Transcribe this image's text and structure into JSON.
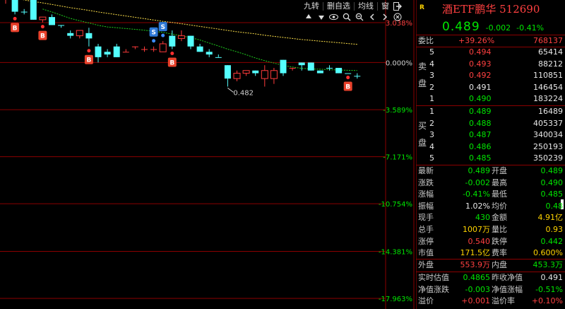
{
  "chart_data": {
    "type": "candlestick",
    "ylim_pct": [
      -18.6,
      3.6
    ],
    "pct_ticks": [
      "3.038%",
      "0.000%",
      "-3.589%",
      "-7.171%",
      "-10.754%",
      "-14.381%",
      "-17.963%"
    ],
    "candles": [
      {
        "o": 0.516,
        "h": 0.519,
        "l": 0.513,
        "c": 0.516,
        "color": "red"
      },
      {
        "o": 0.515,
        "h": 0.516,
        "l": 0.509,
        "c": 0.51,
        "color": "cyan"
      },
      {
        "o": 0.51,
        "h": 0.511,
        "l": 0.509,
        "c": 0.51,
        "color": "cyan"
      },
      {
        "o": 0.515,
        "h": 0.516,
        "l": 0.507,
        "c": 0.507,
        "color": "cyan"
      },
      {
        "o": 0.507,
        "h": 0.508,
        "l": 0.506,
        "c": 0.508,
        "color": "red"
      },
      {
        "o": 0.508,
        "h": 0.509,
        "l": 0.505,
        "c": 0.505,
        "color": "cyan"
      },
      {
        "o": 0.505,
        "h": 0.505,
        "l": 0.504,
        "c": 0.505,
        "color": "cyan"
      },
      {
        "o": 0.502,
        "h": 0.503,
        "l": 0.5,
        "c": 0.501,
        "color": "cyan"
      },
      {
        "o": 0.501,
        "h": 0.503,
        "l": 0.5,
        "c": 0.503,
        "color": "red"
      },
      {
        "o": 0.502,
        "h": 0.504,
        "l": 0.497,
        "c": 0.5,
        "color": "cyan"
      },
      {
        "o": 0.497,
        "h": 0.498,
        "l": 0.491,
        "c": 0.493,
        "color": "cyan"
      },
      {
        "o": 0.494,
        "h": 0.496,
        "l": 0.493,
        "c": 0.495,
        "color": "cyan"
      },
      {
        "o": 0.493,
        "h": 0.498,
        "l": 0.493,
        "c": 0.497,
        "color": "cyan"
      },
      {
        "o": 0.495,
        "h": 0.496,
        "l": 0.495,
        "c": 0.495,
        "color": "red"
      },
      {
        "o": 0.497,
        "h": 0.497,
        "l": 0.496,
        "c": 0.497,
        "color": "red"
      },
      {
        "o": 0.496,
        "h": 0.497,
        "l": 0.495,
        "c": 0.496,
        "color": "red"
      },
      {
        "o": 0.496,
        "h": 0.497,
        "l": 0.495,
        "c": 0.496,
        "color": "red"
      },
      {
        "o": 0.495,
        "h": 0.499,
        "l": 0.495,
        "c": 0.498,
        "color": "red"
      },
      {
        "o": 0.497,
        "h": 0.503,
        "l": 0.496,
        "c": 0.501,
        "color": "cyan"
      },
      {
        "o": 0.5,
        "h": 0.503,
        "l": 0.499,
        "c": 0.501,
        "color": "red"
      },
      {
        "o": 0.501,
        "h": 0.501,
        "l": 0.496,
        "c": 0.497,
        "color": "cyan"
      },
      {
        "o": 0.497,
        "h": 0.498,
        "l": 0.495,
        "c": 0.495,
        "color": "cyan"
      },
      {
        "o": 0.495,
        "h": 0.496,
        "l": 0.493,
        "c": 0.494,
        "color": "cyan"
      },
      {
        "o": 0.493,
        "h": 0.494,
        "l": 0.493,
        "c": 0.493,
        "color": "cyan"
      },
      {
        "o": 0.49,
        "h": 0.49,
        "l": 0.482,
        "c": 0.485,
        "color": "cyan"
      },
      {
        "o": 0.485,
        "h": 0.488,
        "l": 0.484,
        "c": 0.487,
        "color": "red"
      },
      {
        "o": 0.487,
        "h": 0.488,
        "l": 0.486,
        "c": 0.488,
        "color": "red"
      },
      {
        "o": 0.488,
        "h": 0.488,
        "l": 0.486,
        "c": 0.487,
        "color": "cyan"
      },
      {
        "o": 0.485,
        "h": 0.49,
        "l": 0.482,
        "c": 0.488,
        "color": "red"
      },
      {
        "o": 0.488,
        "h": 0.489,
        "l": 0.483,
        "c": 0.485,
        "color": "red"
      },
      {
        "o": 0.487,
        "h": 0.492,
        "l": 0.486,
        "c": 0.492,
        "color": "cyan"
      },
      {
        "o": 0.489,
        "h": 0.489,
        "l": 0.488,
        "c": 0.489,
        "color": "red"
      },
      {
        "o": 0.491,
        "h": 0.491,
        "l": 0.488,
        "c": 0.49,
        "color": "cyan"
      },
      {
        "o": 0.491,
        "h": 0.491,
        "l": 0.488,
        "c": 0.488,
        "color": "cyan"
      },
      {
        "o": 0.488,
        "h": 0.488,
        "l": 0.487,
        "c": 0.487,
        "color": "cyan"
      },
      {
        "o": 0.489,
        "h": 0.49,
        "l": 0.488,
        "c": 0.489,
        "color": "cyan"
      },
      {
        "o": 0.489,
        "h": 0.489,
        "l": 0.487,
        "c": 0.487,
        "color": "cyan"
      },
      {
        "o": 0.487,
        "h": 0.487,
        "l": 0.487,
        "c": 0.487,
        "color": "cyan"
      },
      {
        "o": 0.486,
        "h": 0.487,
        "l": 0.485,
        "c": 0.486,
        "color": "cyan"
      }
    ],
    "ma_yellow": [
      0.5155,
      0.515,
      0.5144,
      0.5138,
      0.5133,
      0.5127,
      0.5121,
      0.5115,
      0.511,
      0.5105,
      0.5099,
      0.5094,
      0.5089,
      0.5084,
      0.5079,
      0.5074,
      0.5069,
      0.5064,
      0.506,
      0.5055,
      0.505,
      0.5045,
      0.504,
      0.5035,
      0.503,
      0.5025,
      0.5021,
      0.5017,
      0.5012,
      0.5008,
      0.5004,
      0.5,
      0.4996,
      0.4993,
      0.499,
      0.4987,
      0.4984,
      0.4981,
      0.4978
    ],
    "ma_green": [
      null,
      null,
      null,
      null,
      0.511,
      0.5099,
      0.5087,
      0.5075,
      0.5066,
      0.5058,
      0.5049,
      0.5043,
      0.504,
      0.5037,
      0.5034,
      0.5031,
      0.5027,
      0.5023,
      0.5016,
      0.501,
      0.5003,
      0.4994,
      0.4983,
      0.4972,
      0.496,
      0.495,
      0.4939,
      0.4927,
      0.4917,
      0.4908,
      0.4899,
      0.4893,
      0.4888,
      0.4886,
      0.4885,
      0.4883,
      0.4882,
      0.4881,
      0.488
    ],
    "low_annotation": "0.482",
    "buy_marks": [
      {
        "i": 1,
        "label": "B"
      },
      {
        "i": 4,
        "label": "B"
      },
      {
        "i": 9,
        "label": "B"
      },
      {
        "i": 18,
        "label": "B"
      },
      {
        "i": 37,
        "label": "B"
      }
    ],
    "sell_marks": [
      {
        "i": 16,
        "label": "S"
      },
      {
        "i": 17,
        "label": "S"
      }
    ]
  },
  "toolbar": {
    "nine_turn": "九转",
    "self_select": "删自选",
    "ma_line": "均线",
    "window": "窗"
  },
  "header": {
    "r_badge": "R",
    "name": "酒ETF鹏华 512690",
    "price": "0.489",
    "change": "-0.002",
    "pct": "-0.41%"
  },
  "ratio": {
    "label": "委比",
    "value": "+39.26%",
    "diff": "768137"
  },
  "sell_side_label": [
    "卖",
    "盘"
  ],
  "buy_side_label": [
    "买",
    "盘"
  ],
  "asks": [
    {
      "n": "5",
      "price": "0.494",
      "vol": "65414",
      "color": "red"
    },
    {
      "n": "4",
      "price": "0.493",
      "vol": "88212",
      "color": "red"
    },
    {
      "n": "3",
      "price": "0.492",
      "vol": "110851",
      "color": "red"
    },
    {
      "n": "2",
      "price": "0.491",
      "vol": "146454",
      "color": "white"
    },
    {
      "n": "1",
      "price": "0.490",
      "vol": "183224",
      "color": "green"
    }
  ],
  "bids": [
    {
      "n": "1",
      "price": "0.489",
      "vol": "16489",
      "color": "green"
    },
    {
      "n": "2",
      "price": "0.488",
      "vol": "405337",
      "color": "green"
    },
    {
      "n": "3",
      "price": "0.487",
      "vol": "340034",
      "color": "green"
    },
    {
      "n": "4",
      "price": "0.486",
      "vol": "250193",
      "color": "green"
    },
    {
      "n": "5",
      "price": "0.485",
      "vol": "350239",
      "color": "green"
    }
  ],
  "stats": [
    {
      "l1": "最新",
      "v1": "0.489",
      "c1": "green",
      "l2": "开盘",
      "v2": "0.489",
      "c2": "green"
    },
    {
      "l1": "涨跌",
      "v1": "-0.002",
      "c1": "green",
      "l2": "最高",
      "v2": "0.490",
      "c2": "green"
    },
    {
      "l1": "涨幅",
      "v1": "-0.41%",
      "c1": "green",
      "l2": "最低",
      "v2": "0.485",
      "c2": "green"
    },
    {
      "l1": "振幅",
      "v1": "1.02%",
      "c1": "white",
      "l2": "均价",
      "v2": "0.48",
      "c2": "green"
    },
    {
      "l1": "现手",
      "v1": "430",
      "c1": "green",
      "l2": "金额",
      "v2": "4.91亿",
      "c2": "yellow"
    },
    {
      "l1": "总手",
      "v1": "1007万",
      "c1": "yellow",
      "l2": "量比",
      "v2": "0.93",
      "c2": "yellow"
    },
    {
      "l1": "涨停",
      "v1": "0.540",
      "c1": "red",
      "l2": "跌停",
      "v2": "0.442",
      "c2": "green"
    },
    {
      "l1": "市值",
      "v1": "171.5亿",
      "c1": "yellow",
      "l2": "费率",
      "v2": "0.600%",
      "c2": "yellow"
    }
  ],
  "flow": [
    {
      "l1": "外盘",
      "v1": "553.9万",
      "c1": "red",
      "l2": "内盘",
      "v2": "453.3万",
      "c2": "green"
    }
  ],
  "valuation": [
    {
      "l1": "实时估值",
      "v1": "0.4865",
      "c1": "green",
      "l2": "昨收净值",
      "v2": "0.491",
      "c2": "white"
    },
    {
      "l1": "净值涨跌",
      "v1": "-0.003",
      "c1": "green",
      "l2": "净值涨幅",
      "v2": "-0.51%",
      "c2": "green"
    },
    {
      "l1": "溢价",
      "v1": "+0.001",
      "c1": "red",
      "l2": "溢价率",
      "v2": "+0.10%",
      "c2": "red"
    }
  ],
  "colors": {
    "up": "#ff3b3b",
    "down": "#54ffff",
    "ma_yellow": "#ffe14a",
    "ma_green": "#1fd11f",
    "grid": "#8b0000",
    "sell_badge": "#2e78d6",
    "buy_badge": "#e8412b"
  }
}
